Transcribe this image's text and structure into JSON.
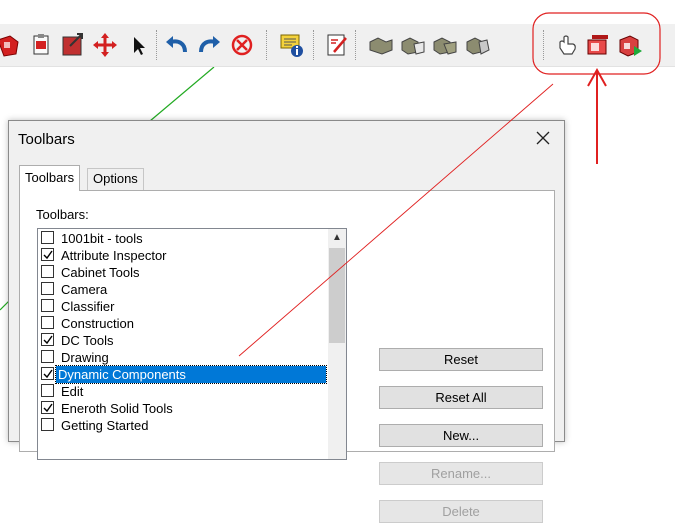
{
  "toolbar": {
    "icons": [
      "dynamic-component-icon",
      "component-options-icon",
      "component-attributes-icon",
      "move-icon",
      "select-arrow-icon",
      "undo-icon",
      "redo-icon",
      "erase-icon",
      "attribute-info-icon",
      "report-icon",
      "solid-union-icon",
      "solid-subtract-icon",
      "solid-trim-icon",
      "solid-split-icon",
      "interact-hand-icon",
      "dynamic-options-icon",
      "dynamic-attributes-icon"
    ]
  },
  "dialog": {
    "title": "Toolbars",
    "tabs": [
      {
        "label": "Toolbars"
      },
      {
        "label": "Options"
      }
    ],
    "list_label": "Toolbars:",
    "items": [
      {
        "label": "1001bit - tools",
        "checked": false
      },
      {
        "label": "Attribute Inspector",
        "checked": true
      },
      {
        "label": "Cabinet Tools",
        "checked": false
      },
      {
        "label": "Camera",
        "checked": false
      },
      {
        "label": "Classifier",
        "checked": false
      },
      {
        "label": "Construction",
        "checked": false
      },
      {
        "label": "DC Tools",
        "checked": true
      },
      {
        "label": "Drawing",
        "checked": false
      },
      {
        "label": "Dynamic Components",
        "checked": true,
        "selected": true
      },
      {
        "label": "Edit",
        "checked": false
      },
      {
        "label": "Eneroth Solid Tools",
        "checked": true
      },
      {
        "label": "Getting Started",
        "checked": false
      }
    ],
    "buttons": [
      {
        "label": "Reset",
        "enabled": true
      },
      {
        "label": "Reset All",
        "enabled": true
      },
      {
        "label": "New...",
        "enabled": true
      },
      {
        "label": "Rename...",
        "enabled": false
      },
      {
        "label": "Delete",
        "enabled": false
      }
    ]
  },
  "colors": {
    "annotation": "#e02020",
    "selection": "#0078d7",
    "axis_green": "#22aa22"
  }
}
